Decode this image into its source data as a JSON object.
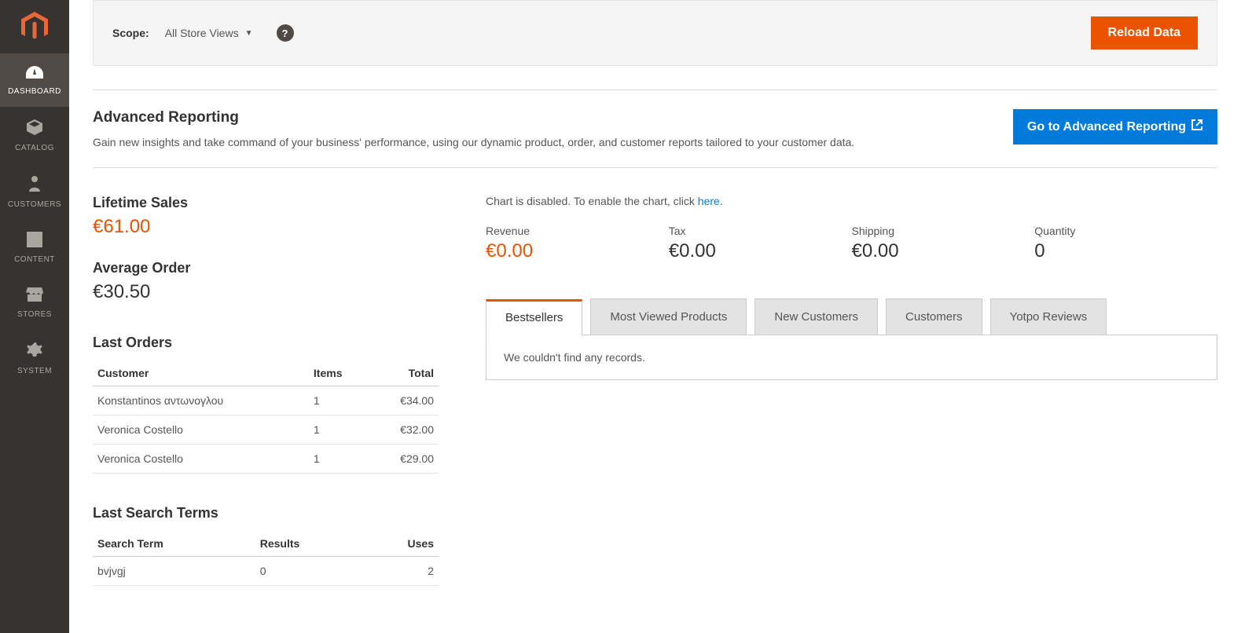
{
  "sidebar": {
    "items": [
      {
        "key": "dashboard",
        "label": "DASHBOARD",
        "active": true
      },
      {
        "key": "catalog",
        "label": "CATALOG",
        "active": false
      },
      {
        "key": "customers",
        "label": "CUSTOMERS",
        "active": false
      },
      {
        "key": "content",
        "label": "CONTENT",
        "active": false
      },
      {
        "key": "stores",
        "label": "STORES",
        "active": false
      },
      {
        "key": "system",
        "label": "SYSTEM",
        "active": false
      }
    ]
  },
  "scopeBar": {
    "label": "Scope:",
    "selected": "All Store Views",
    "reloadButton": "Reload Data"
  },
  "advancedReporting": {
    "title": "Advanced Reporting",
    "description": "Gain new insights and take command of your business' performance, using our dynamic product, order, and customer reports tailored to your customer data.",
    "button": "Go to Advanced Reporting"
  },
  "lifetimeSales": {
    "label": "Lifetime Sales",
    "value": "€61.00"
  },
  "averageOrder": {
    "label": "Average Order",
    "value": "€30.50"
  },
  "lastOrders": {
    "title": "Last Orders",
    "headers": {
      "customer": "Customer",
      "items": "Items",
      "total": "Total"
    },
    "rows": [
      {
        "customer": "Konstantinos αντωνογλου",
        "items": "1",
        "total": "€34.00"
      },
      {
        "customer": "Veronica Costello",
        "items": "1",
        "total": "€32.00"
      },
      {
        "customer": "Veronica Costello",
        "items": "1",
        "total": "€29.00"
      }
    ]
  },
  "lastSearchTerms": {
    "title": "Last Search Terms",
    "headers": {
      "term": "Search Term",
      "results": "Results",
      "uses": "Uses"
    },
    "rows": [
      {
        "term": "bvjvgj",
        "results": "0",
        "uses": "2"
      }
    ]
  },
  "chartDisabled": {
    "prefix": "Chart is disabled. To enable the chart, click ",
    "link": "here",
    "suffix": "."
  },
  "metrics": {
    "revenue": {
      "label": "Revenue",
      "value": "€0.00"
    },
    "tax": {
      "label": "Tax",
      "value": "€0.00"
    },
    "shipping": {
      "label": "Shipping",
      "value": "€0.00"
    },
    "quantity": {
      "label": "Quantity",
      "value": "0"
    }
  },
  "tabs": {
    "items": [
      {
        "key": "bestsellers",
        "label": "Bestsellers",
        "active": true
      },
      {
        "key": "mostviewed",
        "label": "Most Viewed Products",
        "active": false
      },
      {
        "key": "newcust",
        "label": "New Customers",
        "active": false
      },
      {
        "key": "customers",
        "label": "Customers",
        "active": false
      },
      {
        "key": "yotpo",
        "label": "Yotpo Reviews",
        "active": false
      }
    ],
    "noRecords": "We couldn't find any records."
  }
}
